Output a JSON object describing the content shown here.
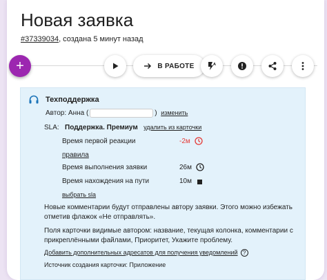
{
  "header": {
    "title": "Новая заявка",
    "ticket_number": "#37339034",
    "created_text": ", создана 5 минут назад"
  },
  "toolbar": {
    "add_label": "+",
    "state_label": "В РАБОТЕ",
    "icons": [
      "play-icon",
      "arrow-right-icon",
      "flash-auto-icon",
      "alert-icon",
      "share-icon",
      "more-vert-icon"
    ]
  },
  "panel": {
    "title": "Техподдержка",
    "author_prefix": "Автор: Анна (",
    "author_suffix": ")",
    "author_change": "изменить",
    "sla_label": "SLA:",
    "sla_value": "Поддержка. Премиум",
    "sla_remove": "удалить из карточки",
    "first_response_label": "Время первой реакции",
    "first_response_value": "-2м",
    "rules_link": "правила",
    "completion_label": "Время выполнения заявки",
    "completion_value": "26м",
    "on_road_label": "Время нахождения на пути",
    "on_road_value": "10м",
    "choose_sla": "выбрать sla",
    "comments_note": "Новые комментарии будут отправлены автору заявки. Этого можно избежать отметив флажок «Не отправлять».",
    "fields_note": "Поля карточки видимые автором: название, текущая колонка, комментарии с прикреплёнными файлами, Приоритет, Укажите проблему.",
    "add_recipients": "Добавить дополнительных адресатов для получения уведомлений",
    "help_mark": "?",
    "source": "Источник создания карточки: Приложение"
  },
  "colors": {
    "accent": "#9c27b0",
    "panel_bg": "#e3f2fb",
    "overdue": "#e53935"
  }
}
